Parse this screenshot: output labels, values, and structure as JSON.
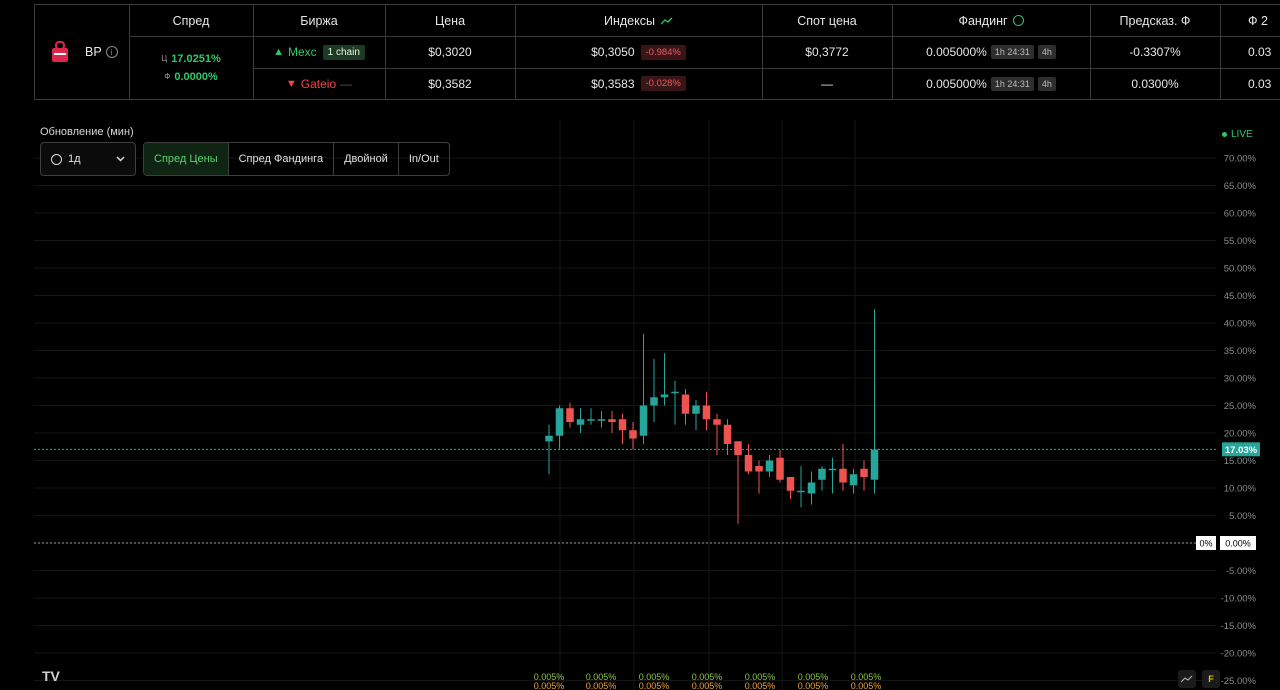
{
  "table": {
    "headers": [
      "Спред",
      "Биржа",
      "Цена",
      "Индексы",
      "Спот цена",
      "Фандинг",
      "Предсказ. Ф",
      "Ф 2"
    ],
    "ticker": "BP",
    "spread_price_prefix": "Ц",
    "spread_price": "17.0251%",
    "spread_funding_prefix": "Ф",
    "spread_funding": "0.0000%",
    "rows": [
      {
        "arrow": "▲",
        "exchange": "Mexc",
        "badge": "1 chain",
        "price": "$0,3020",
        "index": "$0,3050",
        "index_change": "-0.984%",
        "spot": "$0,3772",
        "funding": "0.005000%",
        "funding_timer": "1h 24:31",
        "funding_interval": "4h",
        "pred_funding": "-0.3307%",
        "f2": "0.03"
      },
      {
        "arrow": "▼",
        "exchange": "Gateio",
        "badge": "—",
        "price": "$0,3582",
        "index": "$0,3583",
        "index_change": "-0.028%",
        "spot": "—",
        "funding": "0.005000%",
        "funding_timer": "1h 24:31",
        "funding_interval": "4h",
        "pred_funding": "0.0300%",
        "f2": "0.03"
      }
    ]
  },
  "controls": {
    "update_label": "Обновление (мин)",
    "interval": "1д",
    "tabs": [
      "Спред Цены",
      "Спред Фандинга",
      "Двойной",
      "In/Out"
    ],
    "active_tab": 0
  },
  "live_label": "LIVE",
  "tv_logo": "TV",
  "bottom_buttons": [
    "line-icon",
    "F"
  ],
  "colors": {
    "up": "#26a69a",
    "down": "#ef5350",
    "accent": "#2ec86a",
    "red": "#f0464a"
  },
  "chart_data": {
    "type": "candlestick",
    "y_ticks": [
      "70.00%",
      "65.00%",
      "60.00%",
      "55.00%",
      "50.00%",
      "45.00%",
      "40.00%",
      "35.00%",
      "30.00%",
      "25.00%",
      "20.00%",
      "15.00%",
      "10.00%",
      "5.00%",
      "0.00%",
      "-5.00%",
      "-10.00%",
      "-15.00%",
      "-20.00%",
      "-25.00%"
    ],
    "ylim": [
      -25,
      70
    ],
    "current_value_label": "17.03%",
    "current_value": 17.03,
    "zero_label_left": "0%",
    "zero_label_right": "0.00%",
    "funding_labels_top": [
      "0.005%",
      "0.005%",
      "0.005%",
      "0.005%",
      "0.005%",
      "0.005%",
      "0.005%"
    ],
    "funding_labels_bottom": [
      "0.005%",
      "0.005%",
      "0.005%",
      "0.005%",
      "0.005%",
      "0.005%",
      "0.005%"
    ],
    "candles": [
      {
        "o": 18.5,
        "h": 21.5,
        "l": 12.5,
        "c": 19.5
      },
      {
        "o": 19.5,
        "h": 25.0,
        "l": 17.0,
        "c": 24.5
      },
      {
        "o": 24.5,
        "h": 25.5,
        "l": 21.0,
        "c": 22.0
      },
      {
        "o": 21.5,
        "h": 24.5,
        "l": 20.0,
        "c": 22.5
      },
      {
        "o": 22.5,
        "h": 24.5,
        "l": 21.5,
        "c": 22.5
      },
      {
        "o": 22.5,
        "h": 24.0,
        "l": 21.0,
        "c": 22.5
      },
      {
        "o": 22.5,
        "h": 24.0,
        "l": 20.0,
        "c": 22.0
      },
      {
        "o": 22.5,
        "h": 23.5,
        "l": 18.0,
        "c": 20.5
      },
      {
        "o": 20.5,
        "h": 22.0,
        "l": 17.0,
        "c": 19.0
      },
      {
        "o": 19.5,
        "h": 38.0,
        "l": 18.0,
        "c": 25.0
      },
      {
        "o": 25.0,
        "h": 33.5,
        "l": 22.0,
        "c": 26.5
      },
      {
        "o": 26.5,
        "h": 34.5,
        "l": 25.0,
        "c": 27.0
      },
      {
        "o": 27.5,
        "h": 29.5,
        "l": 21.5,
        "c": 27.5
      },
      {
        "o": 27.0,
        "h": 28.0,
        "l": 21.5,
        "c": 23.5
      },
      {
        "o": 23.5,
        "h": 26.0,
        "l": 20.5,
        "c": 25.0
      },
      {
        "o": 25.0,
        "h": 27.5,
        "l": 20.5,
        "c": 22.5
      },
      {
        "o": 22.5,
        "h": 23.5,
        "l": 16.0,
        "c": 21.5
      },
      {
        "o": 21.5,
        "h": 22.5,
        "l": 16.0,
        "c": 18.0
      },
      {
        "o": 18.5,
        "h": 18.5,
        "l": 3.5,
        "c": 16.0
      },
      {
        "o": 16.0,
        "h": 18.0,
        "l": 12.5,
        "c": 13.0
      },
      {
        "o": 14.0,
        "h": 15.0,
        "l": 9.0,
        "c": 13.0
      },
      {
        "o": 13.0,
        "h": 16.0,
        "l": 12.0,
        "c": 15.0
      },
      {
        "o": 15.5,
        "h": 17.0,
        "l": 11.0,
        "c": 11.5
      },
      {
        "o": 12.0,
        "h": 12.0,
        "l": 8.0,
        "c": 9.5
      },
      {
        "o": 9.5,
        "h": 14.0,
        "l": 6.5,
        "c": 9.5
      },
      {
        "o": 9.0,
        "h": 13.0,
        "l": 7.0,
        "c": 11.0
      },
      {
        "o": 11.5,
        "h": 14.0,
        "l": 9.5,
        "c": 13.5
      },
      {
        "o": 13.5,
        "h": 15.5,
        "l": 9.0,
        "c": 13.5
      },
      {
        "o": 13.5,
        "h": 18.0,
        "l": 9.5,
        "c": 11.0
      },
      {
        "o": 10.5,
        "h": 13.5,
        "l": 9.0,
        "c": 12.5
      },
      {
        "o": 13.5,
        "h": 15.0,
        "l": 9.5,
        "c": 12.0
      },
      {
        "o": 11.5,
        "h": 42.5,
        "l": 9.0,
        "c": 17.0
      }
    ]
  }
}
